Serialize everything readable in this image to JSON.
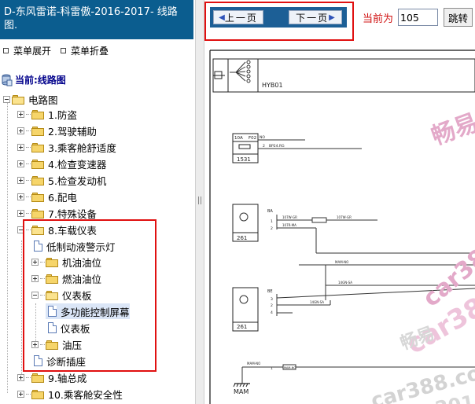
{
  "doc_title": "D-东风雷诺-科雷傲-2016-2017- 线路图.",
  "menu": {
    "expand": "菜单展开",
    "collapse": "菜单折叠"
  },
  "current": "当前:线路图",
  "tree": {
    "root": "电路图",
    "items": [
      "1.防盗",
      "2.驾驶辅助",
      "3.乘客舱舒适度",
      "4.检查变速器",
      "5.检查发动机",
      "6.配电",
      "7.特殊设备",
      "8.车载仪表",
      "低制动液警示灯",
      "机油油位",
      "燃油油位",
      "仪表板",
      "多功能控制屏幕",
      "仪表板",
      "油压",
      "诊断插座",
      "9.轴总成",
      "10.乘客舱安全性"
    ]
  },
  "toolbar": {
    "prev": "上一页",
    "next": "下一页",
    "current_label": "当前为",
    "page_value": "105",
    "jump": "跳转"
  },
  "diagram": {
    "connector_label": "HYB01",
    "fuse_rating": "10A",
    "fuse_id": "F02",
    "box1": "1531",
    "box2": "261",
    "box3": "261",
    "ground": "MAM",
    "wires": [
      "NO",
      "BP24.RG",
      "BA",
      "107W-GR",
      "107W-GR",
      "107R-MA",
      "MAM-NO",
      "BE",
      "14GN-SA",
      "14GN-SA",
      "MAM-NO",
      "MAM-NO"
    ],
    "pins": [
      "2",
      "1",
      "2",
      "3",
      "2",
      "4",
      "1"
    ]
  },
  "watermarks": [
    "畅易",
    "car38",
    "car38",
    "畅易",
    "car388.co",
    "2016"
  ],
  "colors": {
    "title_bg": "#0b5d8f",
    "nav_strip": "#1c5f96",
    "highlight": "#e01010",
    "watermark": "#e4a6c6"
  }
}
